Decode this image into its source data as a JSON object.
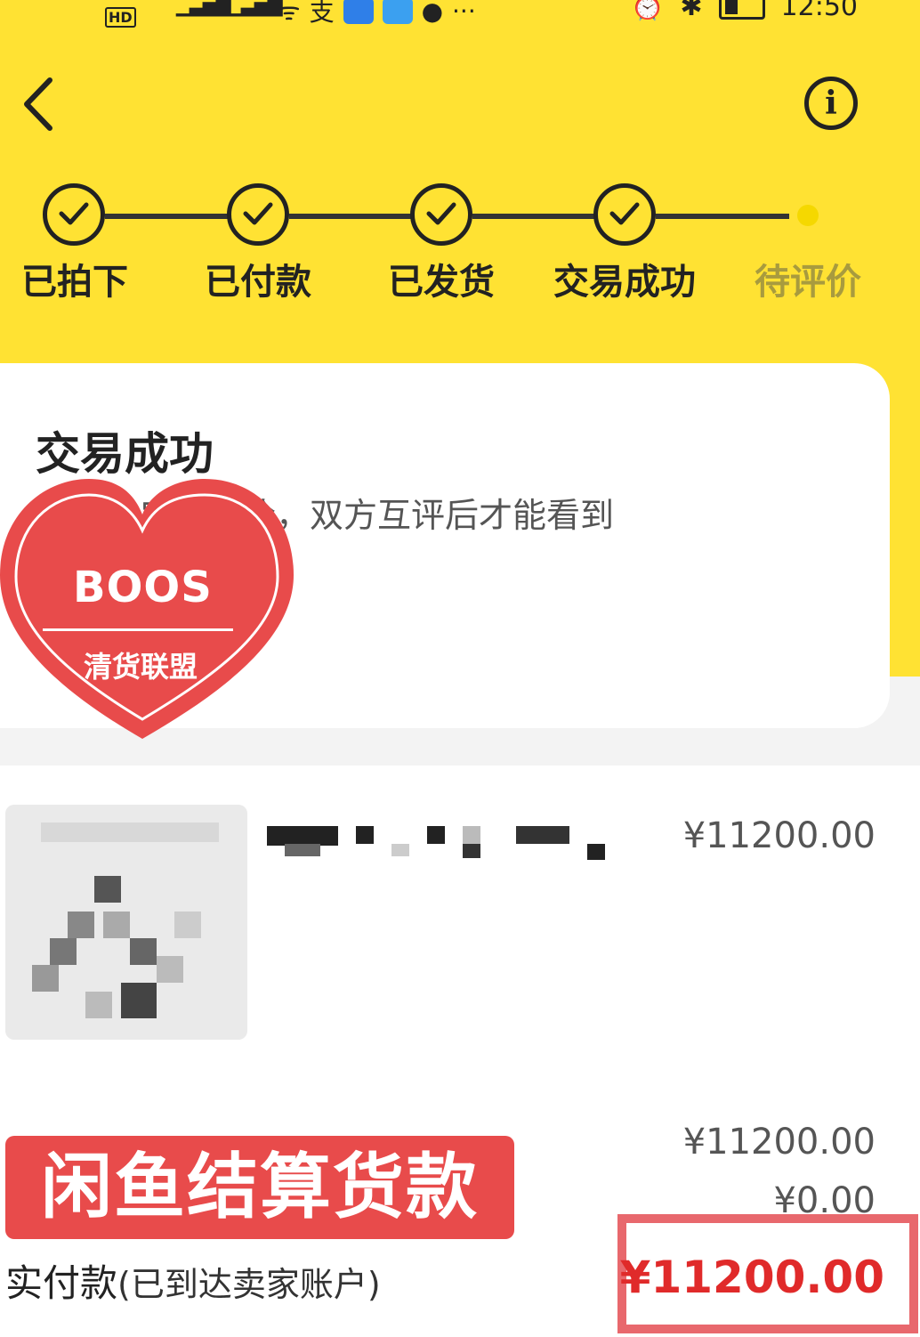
{
  "status_bar": {
    "hd_label": "HD",
    "sim2": "2",
    "time": "12:50"
  },
  "nav": {
    "back_icon": "chevron-left-icon",
    "info_icon": "info-icon"
  },
  "progress": {
    "steps": [
      {
        "label": "已拍下",
        "done": true
      },
      {
        "label": "已付款",
        "done": true
      },
      {
        "label": "已发货",
        "done": true
      },
      {
        "label": "交易成功",
        "done": true
      },
      {
        "label": "待评价",
        "done": false
      }
    ]
  },
  "status_card": {
    "title": "交易成功",
    "description": "内完成评价，双方互评后才能看到"
  },
  "watermark": {
    "title": "BOOS",
    "subtitle": "清货联盟",
    "color": "#e84b4b"
  },
  "product": {
    "price": "¥11200.00"
  },
  "summary": {
    "subtotal": "¥11200.00",
    "discount": "¥0.00",
    "banner_text": "闲鱼结算货款",
    "paid_label": "实付款",
    "paid_note": "(已到达卖家账户)",
    "paid_amount": "¥11200.00"
  },
  "colors": {
    "brand_yellow": "#ffe233",
    "price_red": "#e02a2a",
    "highlight_border": "#e8686d"
  }
}
